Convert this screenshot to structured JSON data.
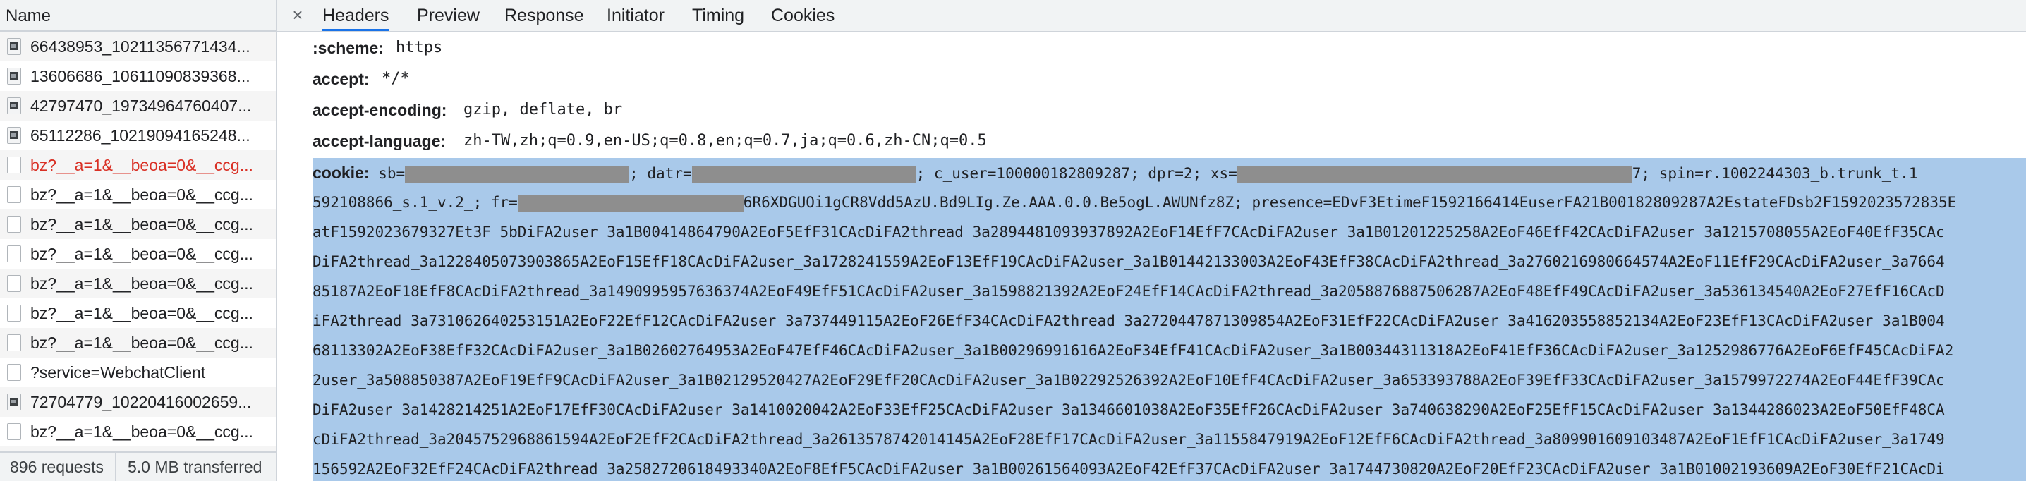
{
  "request_list": {
    "column_header": "Name",
    "rows": [
      {
        "name": "66438953_10211356771434...",
        "type": "image",
        "error": false
      },
      {
        "name": "13606686_10611090839368...",
        "type": "image",
        "error": false
      },
      {
        "name": "42797470_19734964760407...",
        "type": "image",
        "error": false
      },
      {
        "name": "65112286_10219094165248...",
        "type": "image",
        "error": false
      },
      {
        "name": "bz?__a=1&__beoa=0&__ccg...",
        "type": "document",
        "error": true
      },
      {
        "name": "bz?__a=1&__beoa=0&__ccg...",
        "type": "document",
        "error": false
      },
      {
        "name": "bz?__a=1&__beoa=0&__ccg...",
        "type": "document",
        "error": false
      },
      {
        "name": "bz?__a=1&__beoa=0&__ccg...",
        "type": "document",
        "error": false
      },
      {
        "name": "bz?__a=1&__beoa=0&__ccg...",
        "type": "document",
        "error": false
      },
      {
        "name": "bz?__a=1&__beoa=0&__ccg...",
        "type": "document",
        "error": false
      },
      {
        "name": "bz?__a=1&__beoa=0&__ccg...",
        "type": "document",
        "error": false
      },
      {
        "name": "?service=WebchatClient",
        "type": "document",
        "error": false
      },
      {
        "name": "72704779_10220416002659...",
        "type": "image",
        "error": false
      },
      {
        "name": "bz?__a=1&__beoa=0&__ccg...",
        "type": "document",
        "error": false
      },
      {
        "name": "bz?__a=1&__beoa=0&__ccg...",
        "type": "document",
        "error": false
      }
    ],
    "status": {
      "requests": "896 requests",
      "transferred": "5.0 MB transferred"
    }
  },
  "detail": {
    "close_label": "×",
    "tabs": [
      {
        "label": "Headers",
        "active": true
      },
      {
        "label": "Preview",
        "active": false
      },
      {
        "label": "Response",
        "active": false
      },
      {
        "label": "Initiator",
        "active": false
      },
      {
        "label": "Timing",
        "active": false
      },
      {
        "label": "Cookies",
        "active": false
      }
    ],
    "headers": [
      {
        "name": ":scheme:",
        "value": "https"
      },
      {
        "name": "accept:",
        "value": "*/*"
      },
      {
        "name": "accept-encoding:",
        "value": "gzip, deflate, br"
      },
      {
        "name": "accept-language:",
        "value": "zh-TW,zh;q=0.9,en-US;q=0.8,en;q=0.7,ja;q=0.6,zh-CN;q=0.5"
      }
    ],
    "cookie": {
      "name": "cookie:",
      "line1": [
        "sb=",
        "; datr=",
        "; c_user=100000182809287; dpr=2; xs=",
        "7; spin=r.1002244303_b.trunk_t.1"
      ],
      "line2": [
        "592108866_s.1_v.2_; fr=",
        "6R6XDGUOi1gCR8Vdd5AzU.Bd9LIg.Ze.AAA.0.0.Be5ogL.AWUNfz8Z; presence=EDvF3EtimeF1592166414EuserFA21B00182809287A2EstateFDsb2F1592023572835E"
      ],
      "lines": [
        "atF1592023679327Et3F_5bDiFA2user_3a1B00414864790A2EoF5EfF31CAcDiFA2thread_3a2894481093937892A2EoF14EfF7CAcDiFA2user_3a1B01201225258A2EoF46EfF42CAcDiFA2user_3a1215708055A2EoF40EfF35CAc",
        "DiFA2thread_3a1228405073903865A2EoF15EfF18CAcDiFA2user_3a1728241559A2EoF13EfF19CAcDiFA2user_3a1B01442133003A2EoF43EfF38CAcDiFA2thread_3a2760216980664574A2EoF11EfF29CAcDiFA2user_3a7664",
        "85187A2EoF18EfF8CAcDiFA2thread_3a1490995957636374A2EoF49EfF51CAcDiFA2user_3a1598821392A2EoF24EfF14CAcDiFA2thread_3a2058876887506287A2EoF48EfF49CAcDiFA2user_3a536134540A2EoF27EfF16CAcD",
        "iFA2thread_3a731062640253151A2EoF22EfF12CAcDiFA2user_3a737449115A2EoF26EfF34CAcDiFA2thread_3a2720447871309854A2EoF31EfF22CAcDiFA2user_3a416203558852134A2EoF23EfF13CAcDiFA2user_3a1B004",
        "68113302A2EoF38EfF32CAcDiFA2user_3a1B02602764953A2EoF47EfF46CAcDiFA2user_3a1B00296991616A2EoF34EfF41CAcDiFA2user_3a1B00344311318A2EoF41EfF36CAcDiFA2user_3a1252986776A2EoF6EfF45CAcDiFA2",
        "2user_3a508850387A2EoF19EfF9CAcDiFA2user_3a1B02129520427A2EoF29EfF20CAcDiFA2user_3a1B02292526392A2EoF10EfF4CAcDiFA2user_3a653393788A2EoF39EfF33CAcDiFA2user_3a1579972274A2EoF44EfF39CAc",
        "DiFA2user_3a1428214251A2EoF17EfF30CAcDiFA2user_3a1410020042A2EoF33EfF25CAcDiFA2user_3a1346601038A2EoF35EfF26CAcDiFA2user_3a740638290A2EoF25EfF15CAcDiFA2user_3a1344286023A2EoF50EfF48CA",
        "cDiFA2thread_3a2045752968861594A2EoF2EfF2CAcDiFA2thread_3a2613578742014145A2EoF28EfF17CAcDiFA2user_3a1155847919A2EoF12EfF6CAcDiFA2thread_3a809901609103487A2EoF1EfF1CAcDiFA2user_3a1749",
        "156592A2EoF32EfF24CAcDiFA2thread_3a2582720618493340A2EoF8EfF5CAcDiFA2user_3a1B00261564093A2EoF42EfF37CAcDiFA2user_3a1744730820A2EoF20EfF23CAcDiFA2user_3a1B01002193609A2EoF30EfF21CAcDi"
      ]
    }
  }
}
